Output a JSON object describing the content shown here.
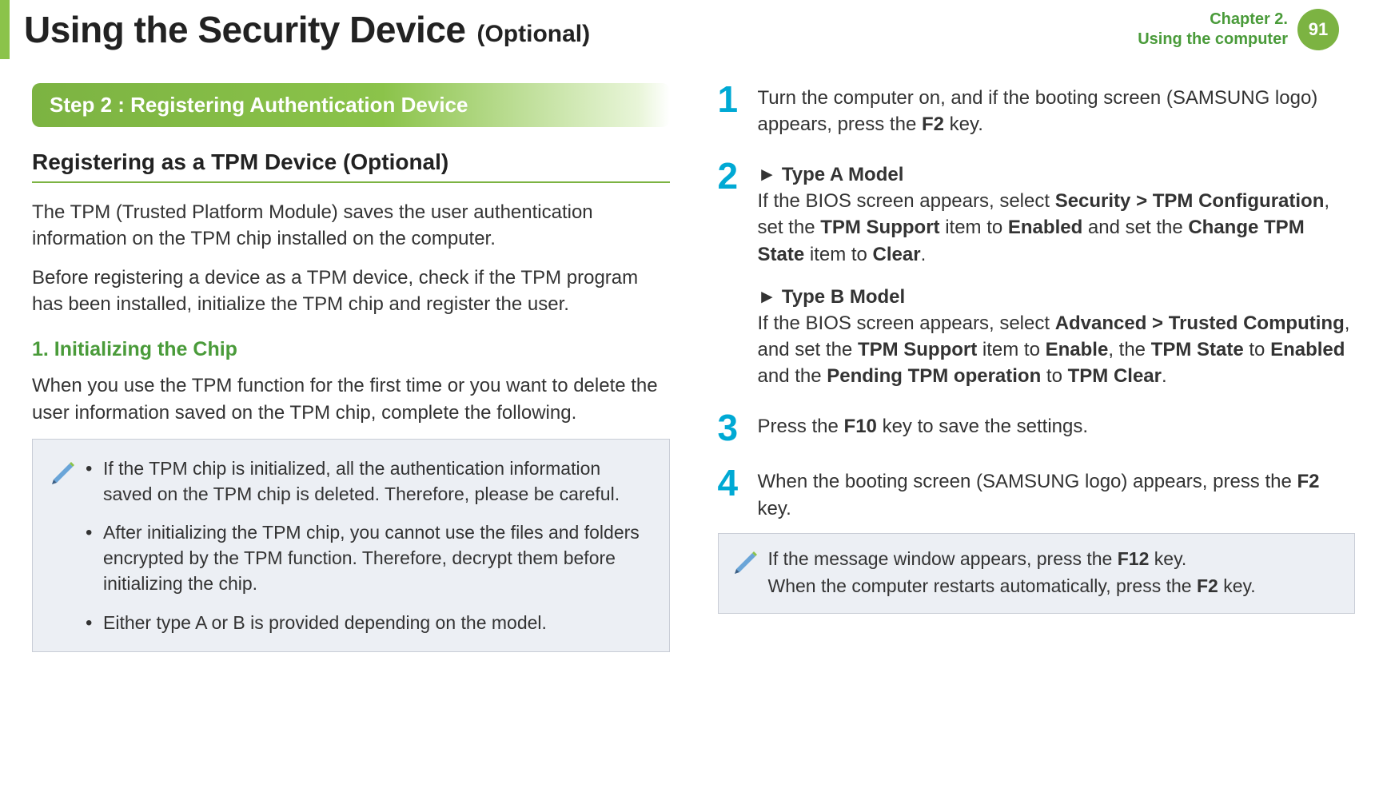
{
  "header": {
    "title": "Using the Security Device",
    "optional": "(Optional)",
    "chapter_line1": "Chapter 2.",
    "chapter_line2": "Using the computer",
    "page_number": "91"
  },
  "left": {
    "step_banner": "Step 2 : Registering Authentication Device",
    "h2": "Registering as a TPM Device (Optional)",
    "para1": "The TPM (Trusted Platform Module) saves the user authentication information on the TPM chip installed on the computer.",
    "para2": "Before registering a device as a TPM device, check if the TPM program has been installed, initialize the TPM chip and register the user.",
    "h3": "1. Initializing the Chip",
    "para3": "When you use the TPM function for the first time or you want to delete the user information saved on the TPM chip, complete the following.",
    "notes": [
      "If the TPM chip is initialized, all the authentication information saved on the TPM chip is deleted. Therefore, please be careful.",
      "After initializing the TPM chip, you cannot use the files and folders encrypted by the TPM function. Therefore, decrypt them before initializing the chip.",
      "Either type A or B is provided depending on the model."
    ]
  },
  "right": {
    "steps": {
      "s1": {
        "num": "1",
        "text_a": "Turn the computer on, and if the booting screen (SAMSUNG logo) appears, press the ",
        "key": "F2",
        "text_b": " key."
      },
      "s2": {
        "num": "2",
        "typeA_label": "► Type A Model",
        "typeA_t1": "If the BIOS screen appears, select ",
        "typeA_b1": "Security > TPM Configuration",
        "typeA_t2": ", set the ",
        "typeA_b2": "TPM Support",
        "typeA_t3": " item to ",
        "typeA_b3": "Enabled",
        "typeA_t4": " and set the ",
        "typeA_b4": "Change TPM State",
        "typeA_t5": " item to ",
        "typeA_b5": "Clear",
        "typeA_t6": ".",
        "typeB_label": "► Type B Model",
        "typeB_t1": "If the BIOS screen appears, select ",
        "typeB_b1": "Advanced > Trusted Computing",
        "typeB_t2": ", and set the ",
        "typeB_b2": "TPM Support",
        "typeB_t3": " item to ",
        "typeB_b3": "Enable",
        "typeB_t4": ", the ",
        "typeB_b4": "TPM State",
        "typeB_t5": " to ",
        "typeB_b5": "Enabled",
        "typeB_t6": " and the ",
        "typeB_b6": "Pending TPM operation",
        "typeB_t7": " to ",
        "typeB_b7": "TPM Clear",
        "typeB_t8": "."
      },
      "s3": {
        "num": "3",
        "text_a": "Press the ",
        "key": "F10",
        "text_b": " key to save the settings."
      },
      "s4": {
        "num": "4",
        "text_a": "When the booting screen (SAMSUNG logo) appears, press the ",
        "key": "F2",
        "text_b": " key."
      }
    },
    "info": {
      "line1_a": "If the message window appears, press the ",
      "line1_key": "F12",
      "line1_b": " key.",
      "line2_a": "When the computer restarts automatically, press the ",
      "line2_key": "F2",
      "line2_b": " key."
    }
  }
}
